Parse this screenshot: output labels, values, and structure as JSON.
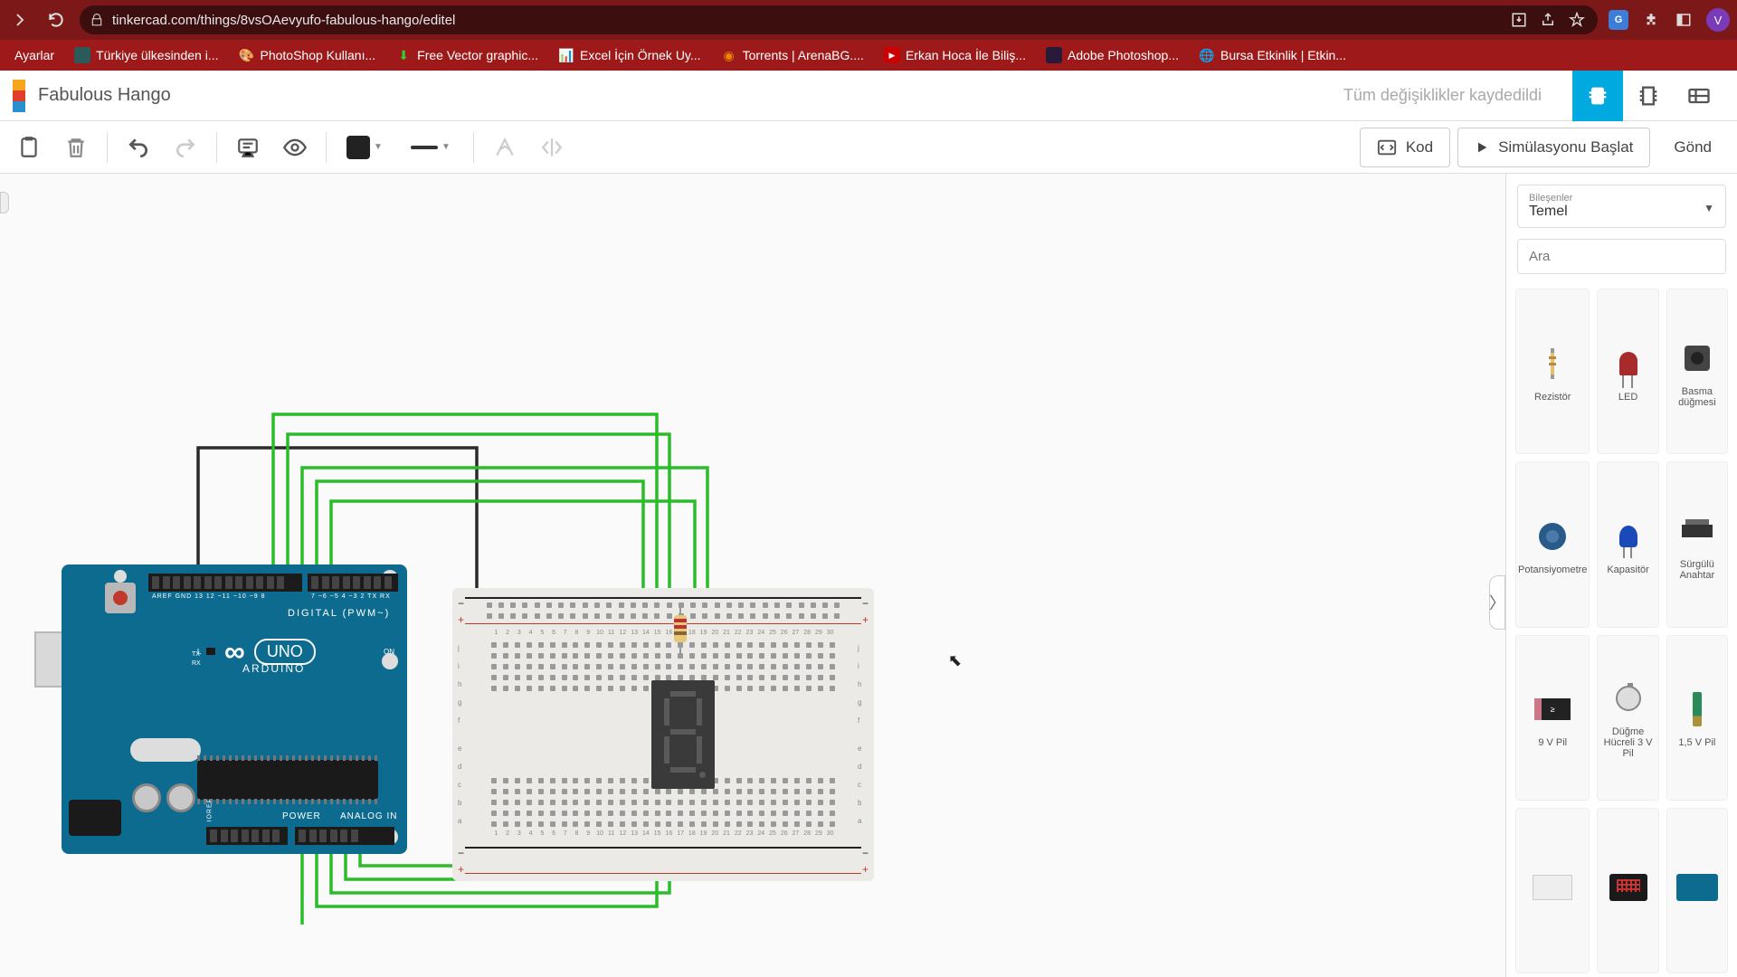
{
  "browser": {
    "url": "tinkercad.com/things/8vsOAevyufo-fabulous-hango/editel",
    "profile_initial": "V"
  },
  "bookmarks": [
    {
      "label": "Ayarlar"
    },
    {
      "label": "Türkiye ülkesinden i..."
    },
    {
      "label": "PhotoShop Kullanı..."
    },
    {
      "label": "Free Vector graphic..."
    },
    {
      "label": "Excel İçin Örnek Uy..."
    },
    {
      "label": "Torrents | ArenaBG...."
    },
    {
      "label": "Erkan Hoca İle Biliş..."
    },
    {
      "label": "Adobe Photoshop..."
    },
    {
      "label": "Bursa Etkinlik | Etkin..."
    }
  ],
  "header": {
    "project_title": "Fabulous Hango",
    "save_status": "Tüm değişiklikler kaydedildi"
  },
  "toolbar": {
    "code_label": "Kod",
    "sim_label": "Simülasyonu Başlat",
    "send_label": "Gönd"
  },
  "arduino": {
    "digital_label": "DIGITAL (PWM~)",
    "brand": "ARDUINO",
    "model": "UNO",
    "power_label": "POWER",
    "analog_label": "ANALOG IN",
    "tx": "TX",
    "rx": "RX",
    "on": "ON"
  },
  "panel": {
    "category_small": "Bileşenler",
    "category_value": "Temel",
    "search_placeholder": "Ara"
  },
  "components": [
    {
      "name": "Rezistör"
    },
    {
      "name": "LED"
    },
    {
      "name": "Basma düğmesi"
    },
    {
      "name": "Potansiyometre"
    },
    {
      "name": "Kapasitör"
    },
    {
      "name": "Sürgülü Anahtar"
    },
    {
      "name": "9 V Pil"
    },
    {
      "name": "Düğme Hücreli 3 V Pil"
    },
    {
      "name": "1,5 V Pil"
    },
    {
      "name": ""
    },
    {
      "name": ""
    },
    {
      "name": ""
    }
  ]
}
